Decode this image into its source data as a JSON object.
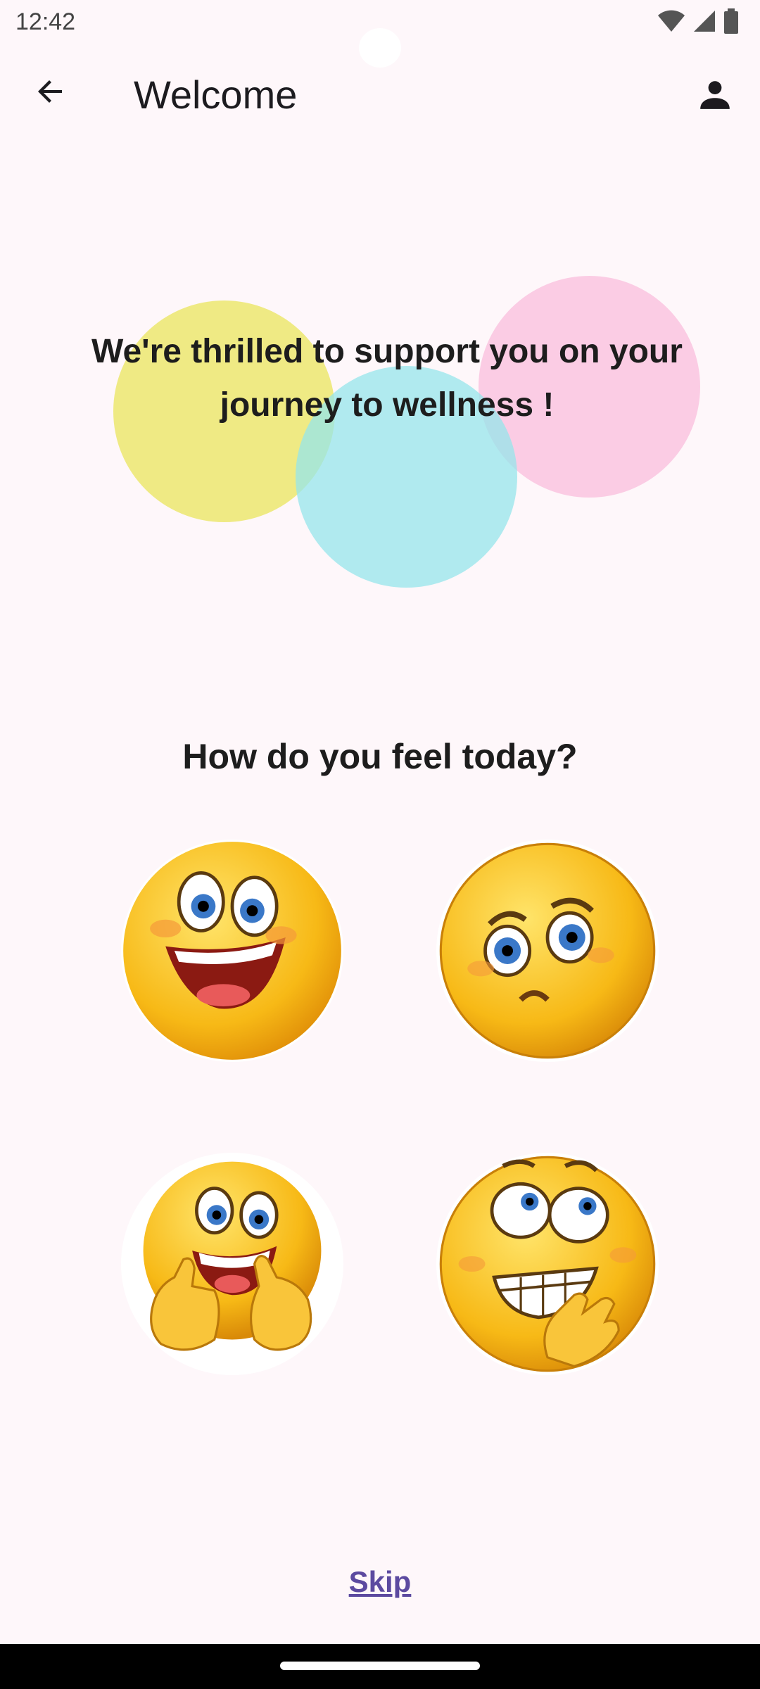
{
  "status_bar": {
    "time": "12:42",
    "icons": [
      "wifi-icon",
      "cellular-signal-icon",
      "battery-icon"
    ]
  },
  "app_bar": {
    "title": "Welcome",
    "back_icon": "arrow-back-icon",
    "profile_icon": "person-icon"
  },
  "hero": {
    "headline": "We're thrilled to support you on your journey to wellness !",
    "circle_colors": [
      "#ece86e",
      "#fabedc",
      "#96e6eb"
    ]
  },
  "mood_prompt": {
    "question": "How do you feel today?",
    "options": [
      {
        "icon": "laughing-face-icon"
      },
      {
        "icon": "worried-face-icon"
      },
      {
        "icon": "thumbs-up-face-icon"
      },
      {
        "icon": "nervous-grin-face-icon"
      }
    ]
  },
  "footer": {
    "skip_label": "Skip"
  },
  "colors": {
    "background": "#fef7fa",
    "accent": "#5c4aa0",
    "emoji_yellow": "#f7b916"
  }
}
